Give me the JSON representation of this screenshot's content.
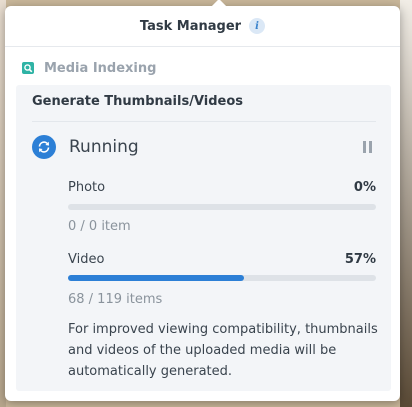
{
  "header": {
    "title": "Task Manager",
    "info_icon": "info-icon"
  },
  "section": {
    "title": "Media Indexing",
    "icon": "media-indexing-icon",
    "accent": "#2fb3a5"
  },
  "card": {
    "title": "Generate Thumbnails/Videos",
    "status": {
      "label": "Running",
      "icon": "sync-icon",
      "action_icon": "pause-icon",
      "color": "#2c7fd6"
    },
    "items": [
      {
        "label": "Photo",
        "percent_text": "0%",
        "progress": 0.0,
        "count": "0 / 0 item"
      },
      {
        "label": "Video",
        "percent_text": "57%",
        "progress": 0.57,
        "count": "68 / 119 items"
      }
    ],
    "note": "For improved viewing compatibility, thumbnails and videos of the uploaded media will be automatically generated."
  }
}
